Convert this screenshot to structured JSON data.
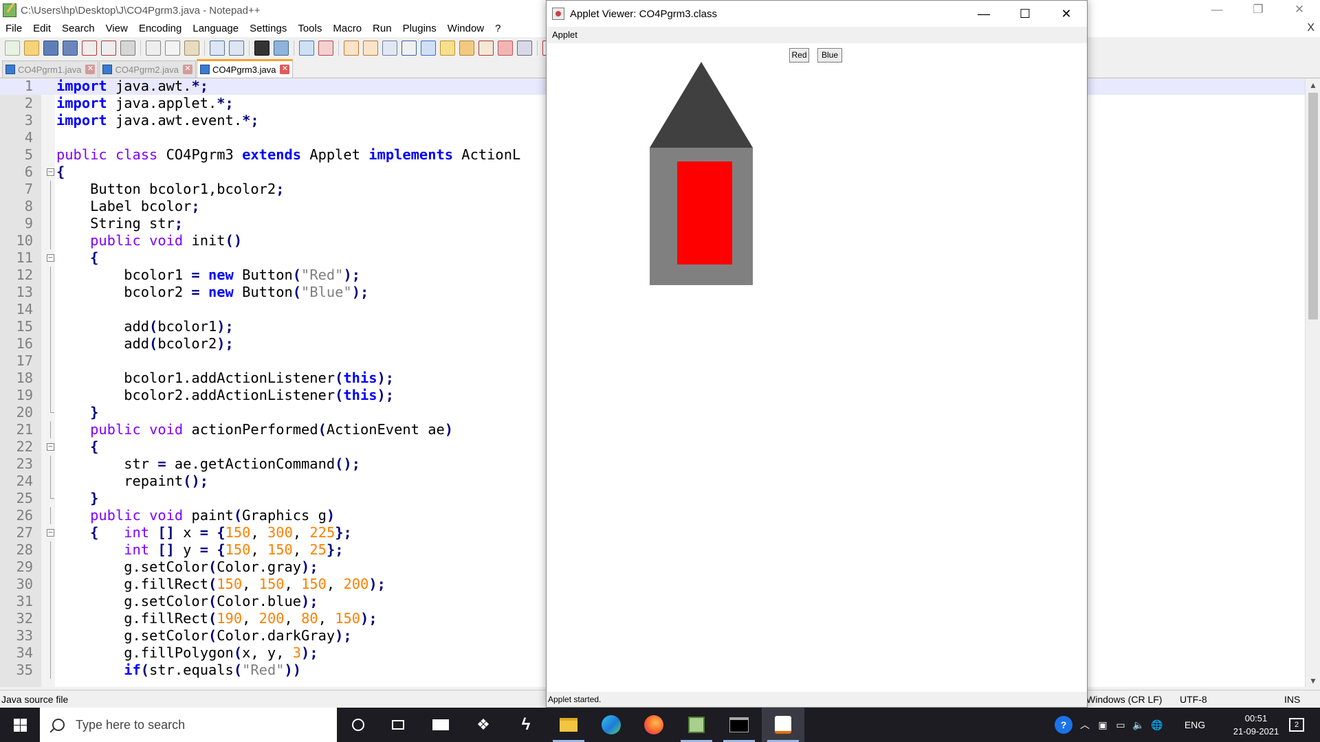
{
  "notepad": {
    "title": "C:\\Users\\hp\\Desktop\\J\\CO4Pgrm3.java - Notepad++",
    "menu": [
      "File",
      "Edit",
      "Search",
      "View",
      "Encoding",
      "Language",
      "Settings",
      "Tools",
      "Macro",
      "Run",
      "Plugins",
      "Window",
      "?"
    ],
    "menu_close": "X",
    "tabs": [
      {
        "label": "CO4Pgrm1.java",
        "active": false
      },
      {
        "label": "CO4Pgrm2.java",
        "active": false
      },
      {
        "label": "CO4Pgrm3.java",
        "active": true
      }
    ],
    "status": {
      "file_type": "Java source file",
      "eol": "Windows (CR LF)",
      "encoding": "UTF-8",
      "mode": "INS"
    },
    "code_lines": [
      "import java.awt.*;",
      "import java.applet.*;",
      "import java.awt.event.*;",
      "",
      "public class CO4Pgrm3 extends Applet implements ActionL",
      "{",
      "    Button bcolor1,bcolor2;",
      "    Label bcolor;",
      "    String str;",
      "    public void init()",
      "    {",
      "        bcolor1 = new Button(\"Red\");",
      "        bcolor2 = new Button(\"Blue\");",
      "",
      "        add(bcolor1);",
      "        add(bcolor2);",
      "",
      "        bcolor1.addActionListener(this);",
      "        bcolor2.addActionListener(this);",
      "    }",
      "    public void actionPerformed(ActionEvent ae)",
      "    {",
      "        str = ae.getActionCommand();",
      "        repaint();",
      "    }",
      "    public void paint(Graphics g)",
      "    {   int [] x = {150, 300, 225};",
      "        int [] y = {150, 150, 25};",
      "        g.setColor(Color.gray);",
      "        g.fillRect(150, 150, 150, 200);",
      "        g.setColor(Color.blue);",
      "        g.fillRect(190, 200, 80, 150);",
      "        g.setColor(Color.darkGray);",
      "        g.fillPolygon(x, y, 3);",
      "        if(str.equals(\"Red\"))"
    ]
  },
  "applet": {
    "title": "Applet Viewer: CO4Pgrm3.class",
    "menu": "Applet",
    "buttons": [
      "Red",
      "Blue"
    ],
    "status": "Applet started.",
    "colors": {
      "roof": "#404040",
      "wall": "#808080",
      "door": "#ff0000"
    }
  },
  "taskbar": {
    "search_placeholder": "Type here to search",
    "language": "ENG",
    "time": "00:51",
    "date": "21-09-2021",
    "notification_count": "2"
  }
}
